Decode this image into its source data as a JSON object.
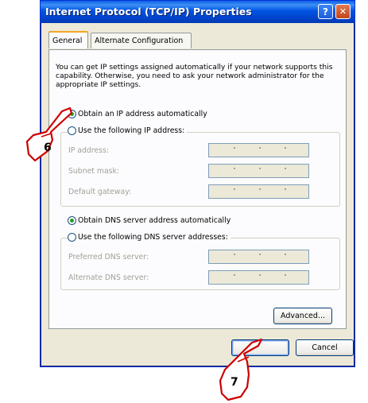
{
  "window": {
    "title": "Internet Protocol (TCP/IP) Properties",
    "help_glyph": "?",
    "close_glyph": "✕"
  },
  "tabs": {
    "general": "General",
    "alternate": "Alternate Configuration"
  },
  "description": "You can get IP settings assigned automatically if your network supports this capability. Otherwise, you need to ask your network administrator for the appropriate IP settings.",
  "ip": {
    "auto_label": "Obtain an IP address automatically",
    "manual_label": "Use the following IP address:",
    "auto_selected": true,
    "fields": {
      "address": "IP address:",
      "subnet": "Subnet mask:",
      "gateway": "Default gateway:"
    }
  },
  "dns": {
    "auto_label": "Obtain DNS server address automatically",
    "manual_label": "Use the following DNS server addresses:",
    "auto_selected": true,
    "fields": {
      "preferred": "Preferred DNS server:",
      "alternate": "Alternate DNS server:"
    }
  },
  "buttons": {
    "advanced": "Advanced...",
    "ok": "",
    "cancel": "Cancel"
  },
  "annotations": {
    "step_6": "6",
    "step_7": "7"
  }
}
